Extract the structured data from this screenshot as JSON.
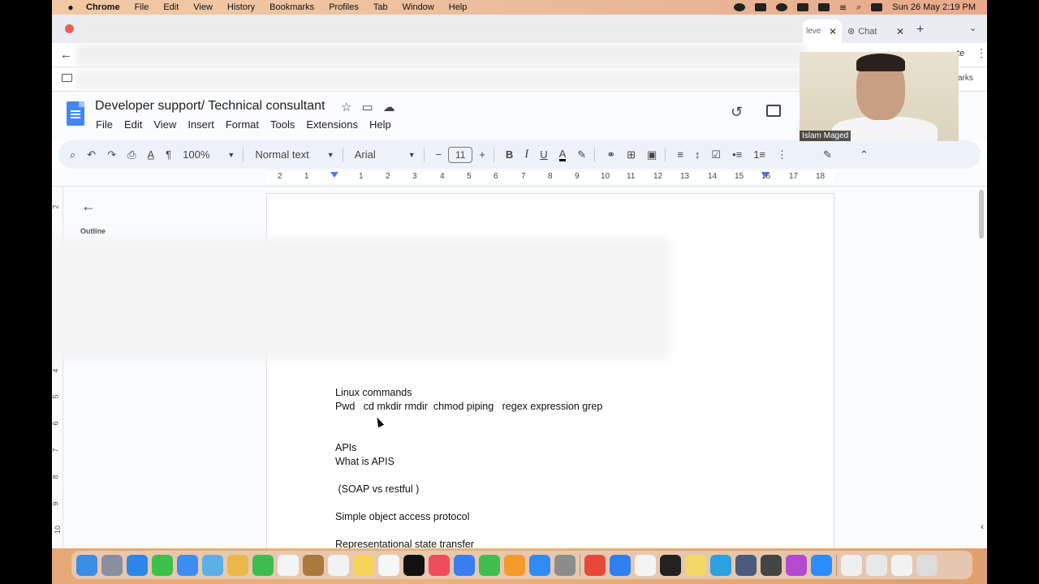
{
  "menubar": {
    "app_name": "Chrome",
    "items": [
      "File",
      "Edit",
      "View",
      "History",
      "Bookmarks",
      "Profiles",
      "Tab",
      "Window",
      "Help"
    ],
    "clock": "Sun 26 May  2:19 PM"
  },
  "browser": {
    "tab_partial_title": "leve",
    "tab_chat_title": "Chat",
    "toolbar_partial_text": "te",
    "bookmarks_partial_text": "arks"
  },
  "docs": {
    "title": "Developer support/ Technical consultant",
    "menu": [
      "File",
      "Edit",
      "View",
      "Insert",
      "Format",
      "Tools",
      "Extensions",
      "Help"
    ],
    "zoom": "100%",
    "style": "Normal text",
    "font": "Arial",
    "font_size": "11",
    "ruler_numbers": [
      "2",
      "1",
      "1",
      "2",
      "3",
      "4",
      "5",
      "6",
      "7",
      "8",
      "9",
      "10",
      "11",
      "12",
      "13",
      "14",
      "15",
      "16",
      "17",
      "18"
    ],
    "vruler_numbers": [
      "2",
      "4",
      "5",
      "6",
      "7",
      "8",
      "9",
      "10"
    ],
    "outline_label": "Outline"
  },
  "document": {
    "lines": [
      "Linux commands",
      "Pwd   cd mkdir rmdir  chmod piping   regex expression grep",
      "APIs",
      "What is APIS",
      " (SOAP vs restful )",
      "Simple object access protocol",
      "Representational state transfer"
    ]
  },
  "webcam": {
    "name": "Islam Maged"
  },
  "colors": {
    "docs_blue": "#4285f4",
    "toolbar_bg": "#edf2fa",
    "menubar_bg": "#f2c9a4"
  }
}
